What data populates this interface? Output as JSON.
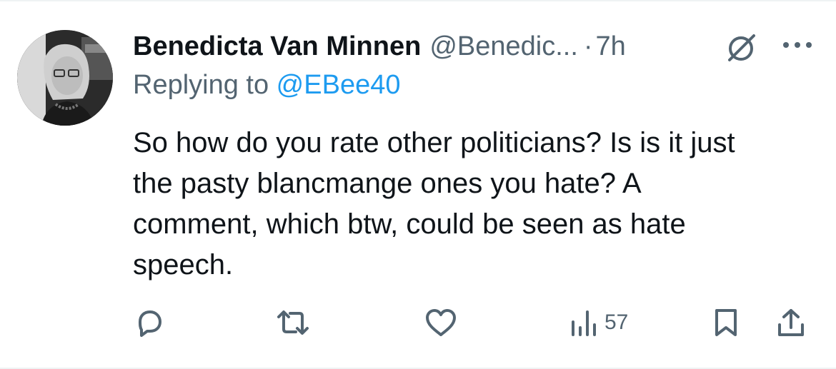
{
  "author": {
    "display_name": "Benedicta Van Minnen",
    "handle": "@Benedic...",
    "separator": "·",
    "time": "7h",
    "avatar": "profile-photo"
  },
  "reply": {
    "prefix": "Replying to ",
    "mention": "@EBee40"
  },
  "body": {
    "lines": [
      "So how do you rate other politicians? Is is it just",
      "the pasty blancmange ones you hate? A",
      "comment, which btw, could be seen as hate",
      "speech."
    ]
  },
  "icons": {
    "header": [
      "no-sign-icon",
      "more-options-icon"
    ],
    "actions": [
      "reply-icon",
      "retweet-icon",
      "like-icon",
      "views-icon",
      "bookmark-icon",
      "share-icon"
    ]
  },
  "actions": {
    "views_count": "57"
  },
  "colors": {
    "text": "#0f1419",
    "secondary": "#536471",
    "link": "#1d9bf0"
  }
}
